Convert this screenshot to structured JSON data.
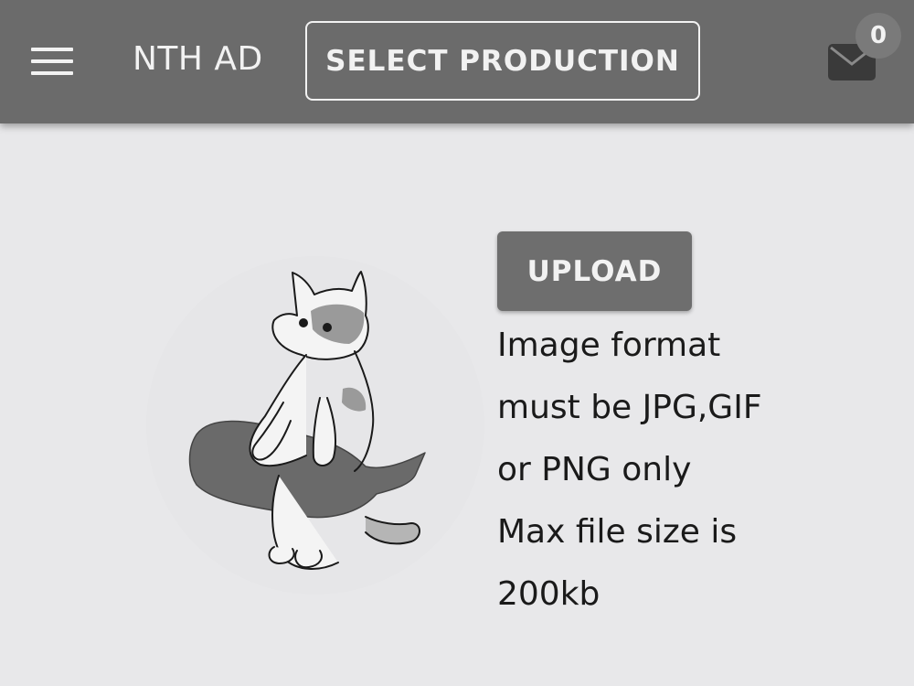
{
  "header": {
    "brand": "NTH AD",
    "select_production_label": "SELECT PRODUCTION",
    "notification_count": "0",
    "menu_icon": "hamburger-menu-icon",
    "mail_icon": "mail-icon"
  },
  "main": {
    "avatar_alt": "cat-illustration",
    "upload_label": "UPLOAD",
    "info_lines": [
      "Image format",
      "must be JPG,GIF",
      "or PNG only",
      "Max file size is",
      "200kb"
    ]
  },
  "colors": {
    "topbar": "#6b6b6b",
    "background": "#e8e8ea",
    "upload_button": "#6e6e6e"
  }
}
